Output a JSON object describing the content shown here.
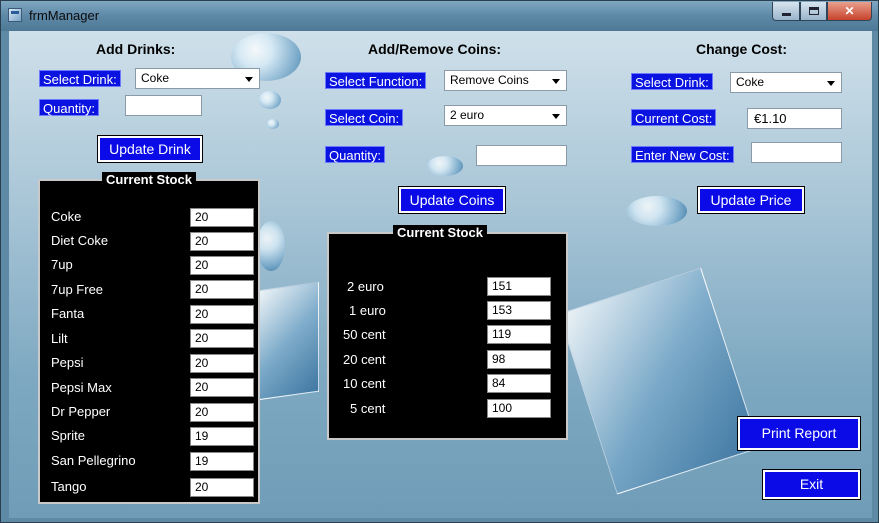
{
  "window": {
    "title": "frmManager"
  },
  "add_drinks": {
    "heading": "Add Drinks:",
    "select_drink_label": "Select Drink:",
    "select_drink_value": "Coke",
    "quantity_label": "Quantity:",
    "quantity_value": "",
    "update_button": "Update Drink"
  },
  "coins": {
    "heading": "Add/Remove Coins:",
    "select_function_label": "Select Function:",
    "select_function_value": "Remove Coins",
    "select_coin_label": "Select Coin:",
    "select_coin_value": "2 euro",
    "quantity_label": "Quantity:",
    "quantity_value": "",
    "update_button": "Update Coins"
  },
  "change_cost": {
    "heading": "Change Cost:",
    "select_drink_label": "Select Drink:",
    "select_drink_value": "Coke",
    "current_cost_label": "Current Cost:",
    "current_cost_value": "€1.10",
    "new_cost_label": "Enter New Cost:",
    "new_cost_value": "",
    "update_button": "Update Price"
  },
  "drink_stock": {
    "title": "Current Stock",
    "items": [
      {
        "name": "Coke",
        "value": "20"
      },
      {
        "name": "Diet Coke",
        "value": "20"
      },
      {
        "name": "7up",
        "value": "20"
      },
      {
        "name": "7up Free",
        "value": "20"
      },
      {
        "name": "Fanta",
        "value": "20"
      },
      {
        "name": "Lilt",
        "value": "20"
      },
      {
        "name": "Pepsi",
        "value": "20"
      },
      {
        "name": "Pepsi Max",
        "value": "20"
      },
      {
        "name": "Dr Pepper",
        "value": "20"
      },
      {
        "name": "Sprite",
        "value": "19"
      },
      {
        "name": "San Pellegrino",
        "value": "19"
      },
      {
        "name": "Tango",
        "value": "20"
      }
    ]
  },
  "coin_stock": {
    "title": "Current Stock",
    "items": [
      {
        "name": "2 euro",
        "value": "151"
      },
      {
        "name": "1 euro",
        "value": "153"
      },
      {
        "name": "50 cent",
        "value": "119"
      },
      {
        "name": "20 cent",
        "value": "98"
      },
      {
        "name": "10 cent",
        "value": "84"
      },
      {
        "name": "5 cent",
        "value": "100"
      }
    ]
  },
  "actions": {
    "print_report": "Print Report",
    "exit": "Exit"
  }
}
